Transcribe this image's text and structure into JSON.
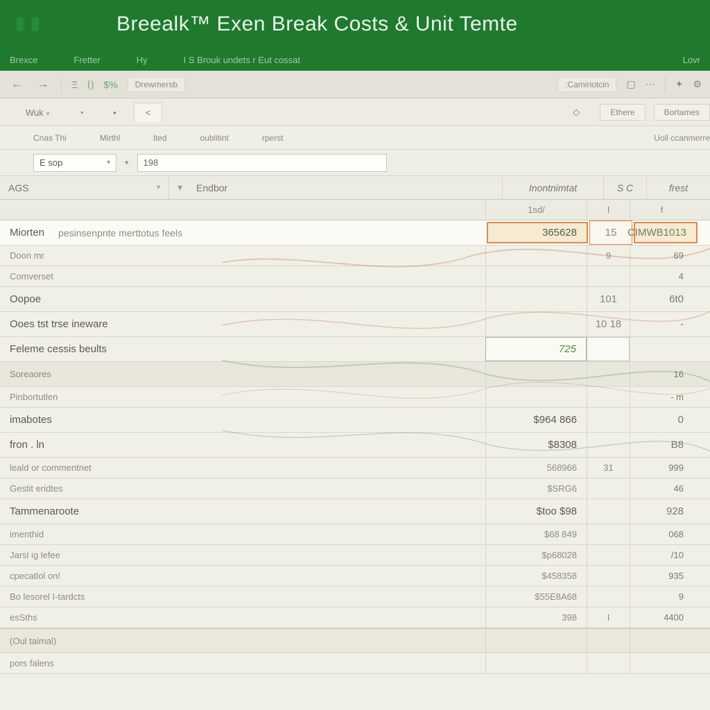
{
  "title": "Breealk™ Exen  Break Costs & Unit Temte",
  "menu": {
    "m1": "Brexce",
    "m2": "Fretter",
    "m3": "Hy",
    "m4": "I S Brouk undets r Eut cossat",
    "m5": "Lovr"
  },
  "toolbar": {
    "chip1": "Drewmersb",
    "chip2": ":Camiriotcin"
  },
  "ribbon": {
    "tab1": "Wuk",
    "tab_active": "<",
    "chip1": "Ethere",
    "chip2": "Bortames"
  },
  "groups": {
    "g1": "Cnas Thi",
    "g2": "Mirthl",
    "g3": "lted",
    "g4": "oublitint",
    "g5": "rperst",
    "g6": "Uoll ccanmerre"
  },
  "fx": {
    "namebox": "E sop",
    "formula": "198"
  },
  "colhdr": {
    "a": "AGS",
    "b": "Endbor",
    "c": "Inontnimtat",
    "d": "S C",
    "e": "frest"
  },
  "subhdr": {
    "c": "1sd/",
    "d": "I",
    "e": "f"
  },
  "rows": [
    {
      "kind": "hi hl",
      "label": "Miorten",
      "sublabel": "pesinsenpnte merttotus feels",
      "val": "365628",
      "mid": "15",
      "end": "CIMWB1013"
    },
    {
      "kind": "small",
      "label": "Doon mr",
      "val": "",
      "mid": "9",
      "end": "69"
    },
    {
      "kind": "small",
      "label": "Comverset",
      "val": "",
      "mid": "",
      "end": "4"
    },
    {
      "kind": "",
      "label": "Oopoe",
      "val": "",
      "mid": "101",
      "end": "6t0"
    },
    {
      "kind": "",
      "label": "Ooes tst trse ineware",
      "val": "",
      "mid": "10  18",
      "end": "-"
    },
    {
      "kind": "input",
      "label": "Feleme cessis beults",
      "val": "725",
      "mid": "",
      "end": ""
    },
    {
      "kind": "section",
      "label": "Soreaores",
      "val": "",
      "mid": "",
      "end": "16"
    },
    {
      "kind": "small",
      "label": "Pinbortutlen",
      "val": "",
      "mid": "",
      "end": "- m"
    },
    {
      "kind": "",
      "label": "imabotes",
      "val": "$964 866",
      "mid": "",
      "end": "0"
    },
    {
      "kind": "",
      "label": "fron . ln",
      "val": "$8308",
      "mid": "",
      "end": "B8"
    },
    {
      "kind": "small",
      "label": "leald or commentnet",
      "val": "568966",
      "mid": "31",
      "end": "999"
    },
    {
      "kind": "small",
      "label": "Gestit eridtes",
      "val": "$SRG6",
      "mid": "",
      "end": "46"
    },
    {
      "kind": "",
      "label": "Tammenaroote",
      "val": "$too $98",
      "mid": "",
      "end": "928"
    },
    {
      "kind": "small",
      "label": "imenthid",
      "val": "$68 849",
      "mid": "",
      "end": "068"
    },
    {
      "kind": "small",
      "label": "Jarsl ig lefee",
      "val": "$p68028",
      "mid": "",
      "end": "/10"
    },
    {
      "kind": "small",
      "label": "cpecatlol on!",
      "val": "$458358",
      "mid": "",
      "end": "935"
    },
    {
      "kind": "small",
      "label": "Bo lesorel I-tardcts",
      "val": "$55E8A68",
      "mid": "",
      "end": "9"
    },
    {
      "kind": "small",
      "label": "esSths",
      "val": "398",
      "mid": "I",
      "end": "4400"
    },
    {
      "kind": "subtotal",
      "label": "(Oul taimal)",
      "val": "",
      "mid": "",
      "end": ""
    },
    {
      "kind": "small",
      "label": "pors falens",
      "val": "",
      "mid": "",
      "end": ""
    }
  ]
}
